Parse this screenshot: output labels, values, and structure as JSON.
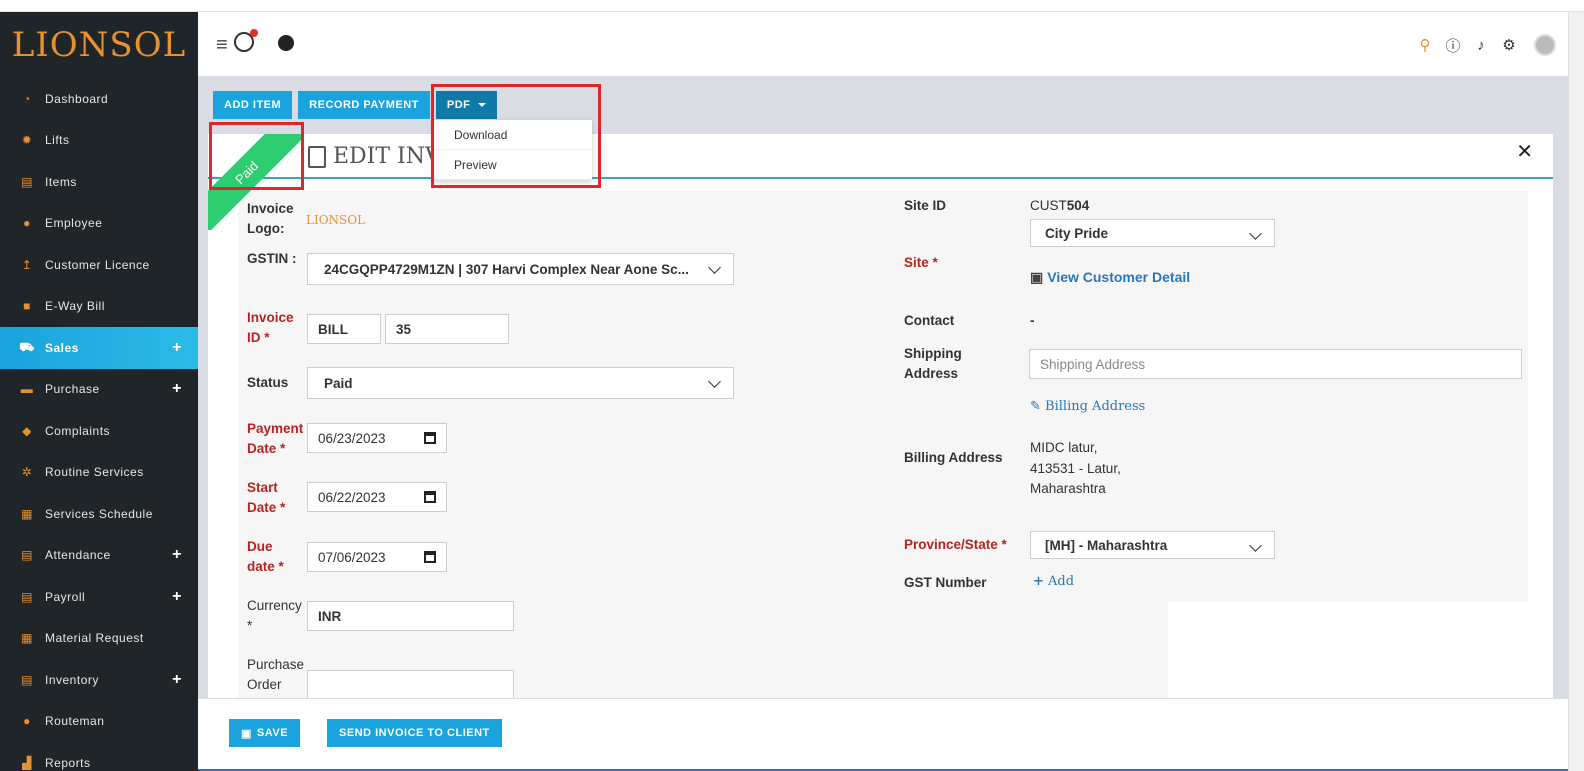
{
  "sidebar": {
    "logo": "LIONSOL",
    "items": [
      {
        "label": "Dashboard",
        "icon": "dashboard-icon",
        "plus": false
      },
      {
        "label": "Lifts",
        "icon": "gear-icon",
        "plus": false
      },
      {
        "label": "Items",
        "icon": "box-icon",
        "plus": false
      },
      {
        "label": "Employee",
        "icon": "user-icon",
        "plus": false
      },
      {
        "label": "Customer Licence",
        "icon": "upload-icon",
        "plus": false
      },
      {
        "label": "E-Way Bill",
        "icon": "truck-icon",
        "plus": false
      },
      {
        "label": "Sales",
        "icon": "cart-icon",
        "plus": true,
        "active": true
      },
      {
        "label": "Purchase",
        "icon": "briefcase-icon",
        "plus": true
      },
      {
        "label": "Complaints",
        "icon": "tag-icon",
        "plus": false
      },
      {
        "label": "Routine Services",
        "icon": "cogs-icon",
        "plus": false
      },
      {
        "label": "Services Schedule",
        "icon": "grid-icon",
        "plus": false
      },
      {
        "label": "Attendance",
        "icon": "box-icon",
        "plus": true
      },
      {
        "label": "Payroll",
        "icon": "box-icon",
        "plus": true
      },
      {
        "label": "Material Request",
        "icon": "grid-icon",
        "plus": false
      },
      {
        "label": "Inventory",
        "icon": "box-icon",
        "plus": true
      },
      {
        "label": "Routeman",
        "icon": "users-icon",
        "plus": false
      },
      {
        "label": "Reports",
        "icon": "chart-icon",
        "plus": false
      }
    ]
  },
  "toolbar": {
    "add_item": "ADD ITEM",
    "record_payment": "RECORD PAYMENT",
    "pdf": "PDF",
    "pdf_menu": [
      "Download",
      "Preview"
    ]
  },
  "panel": {
    "title": "EDIT INV",
    "ribbon": "Paid"
  },
  "form": {
    "invoice_logo_label": "Invoice Logo:",
    "invoice_logo": "LIONSOL",
    "gstin_label": "GSTIN :",
    "gstin_value": "24CGQPP4729M1ZN | 307 Harvi Complex Near Aone Sc...",
    "invoice_id_label": "Invoice ID *",
    "invoice_prefix": "BILL",
    "invoice_number": "35",
    "status_label": "Status",
    "status_value": "Paid",
    "payment_date_label": "Payment Date *",
    "payment_date": "06/23/2023",
    "start_date_label": "Start Date *",
    "start_date": "06/22/2023",
    "due_date_label": "Due date *",
    "due_date": "07/06/2023",
    "currency_label": "Currency *",
    "currency_value": "INR",
    "purchase_order_label": "Purchase Order",
    "site_id_label": "Site ID",
    "site_id_prefix": "CUST",
    "site_id_number": "504",
    "site_label": "Site *",
    "site_value": "City Pride",
    "view_customer": "View Customer Detail",
    "contact_label": "Contact",
    "contact_value": "-",
    "shipping_label": "Shipping Address",
    "shipping_placeholder": "Shipping Address",
    "billing_link": "Billing Address",
    "billing_label": "Billing Address",
    "billing_line1": "MIDC latur,",
    "billing_line2": "413531 - Latur,",
    "billing_line3": "Maharashtra",
    "province_label": "Province/State *",
    "province_value": "[MH] - Maharashtra",
    "gst_label": "GST Number",
    "gst_add": "Add"
  },
  "footer": {
    "save": "SAVE",
    "send": "SEND INVOICE TO CLIENT"
  },
  "colors": {
    "sidebar_bg": "#1f2528",
    "accent": "#1aa3dc",
    "required": "#b52323",
    "ribbon": "#2ecc71",
    "highlight": "#e0262a"
  }
}
